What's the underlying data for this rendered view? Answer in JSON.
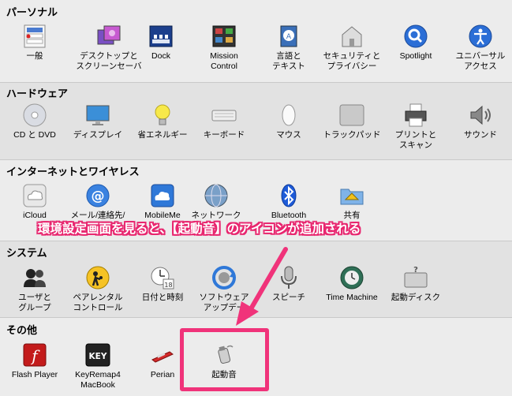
{
  "colors": {
    "accent": "#f0337a",
    "annotation": "#e8266f"
  },
  "annotation_text": "環境設定画面を見ると、【起動音】のアイコンが追加される",
  "sections": [
    {
      "title": "パーソナル",
      "items": [
        {
          "label": "一般",
          "icon": "general-icon"
        },
        {
          "label": "デスクトップと\nスクリーンセーバ",
          "icon": "desktop-icon"
        },
        {
          "label": "Dock",
          "icon": "dock-icon"
        },
        {
          "label": "Mission\nControl",
          "icon": "mission-control-icon"
        },
        {
          "label": "言語と\nテキスト",
          "icon": "language-icon"
        },
        {
          "label": "セキュリティと\nプライバシー",
          "icon": "security-icon"
        },
        {
          "label": "Spotlight",
          "icon": "spotlight-icon"
        },
        {
          "label": "ユニバーサル\nアクセス",
          "icon": "accessibility-icon"
        }
      ]
    },
    {
      "title": "ハードウェア",
      "items": [
        {
          "label": "CD と DVD",
          "icon": "cd-dvd-icon"
        },
        {
          "label": "ディスプレイ",
          "icon": "display-icon"
        },
        {
          "label": "省エネルギー",
          "icon": "energy-icon"
        },
        {
          "label": "キーボード",
          "icon": "keyboard-icon"
        },
        {
          "label": "マウス",
          "icon": "mouse-icon"
        },
        {
          "label": "トラックパッド",
          "icon": "trackpad-icon"
        },
        {
          "label": "プリントと\nスキャン",
          "icon": "printer-icon"
        },
        {
          "label": "サウンド",
          "icon": "sound-icon"
        }
      ]
    },
    {
      "title": "インターネットとワイヤレス",
      "items": [
        {
          "label": "iCloud",
          "icon": "icloud-icon"
        },
        {
          "label": "メール/連絡先/",
          "icon": "mail-icon"
        },
        {
          "label": "MobileMe",
          "icon": "mobileme-icon"
        },
        {
          "label": "ネットワーク",
          "icon": "network-icon"
        },
        {
          "label": "Bluetooth",
          "icon": "bluetooth-icon"
        },
        {
          "label": "共有",
          "icon": "sharing-icon"
        }
      ]
    },
    {
      "title": "システム",
      "items": [
        {
          "label": "ユーザと\nグループ",
          "icon": "users-icon"
        },
        {
          "label": "ペアレンタル\nコントロール",
          "icon": "parental-icon"
        },
        {
          "label": "日付と時刻",
          "icon": "datetime-icon"
        },
        {
          "label": "ソフトウェア\nアップデー",
          "icon": "software-update-icon"
        },
        {
          "label": "スピーチ",
          "icon": "speech-icon"
        },
        {
          "label": "Time Machine",
          "icon": "time-machine-icon"
        },
        {
          "label": "起動ディスク",
          "icon": "startup-disk-icon"
        }
      ]
    },
    {
      "title": "その他",
      "items": [
        {
          "label": "Flash Player",
          "icon": "flash-icon"
        },
        {
          "label": "KeyRemap4\nMacBook",
          "icon": "keyremap-icon"
        },
        {
          "label": "Perian",
          "icon": "perian-icon"
        },
        {
          "label": "起動音",
          "icon": "startup-sound-icon"
        }
      ]
    }
  ]
}
